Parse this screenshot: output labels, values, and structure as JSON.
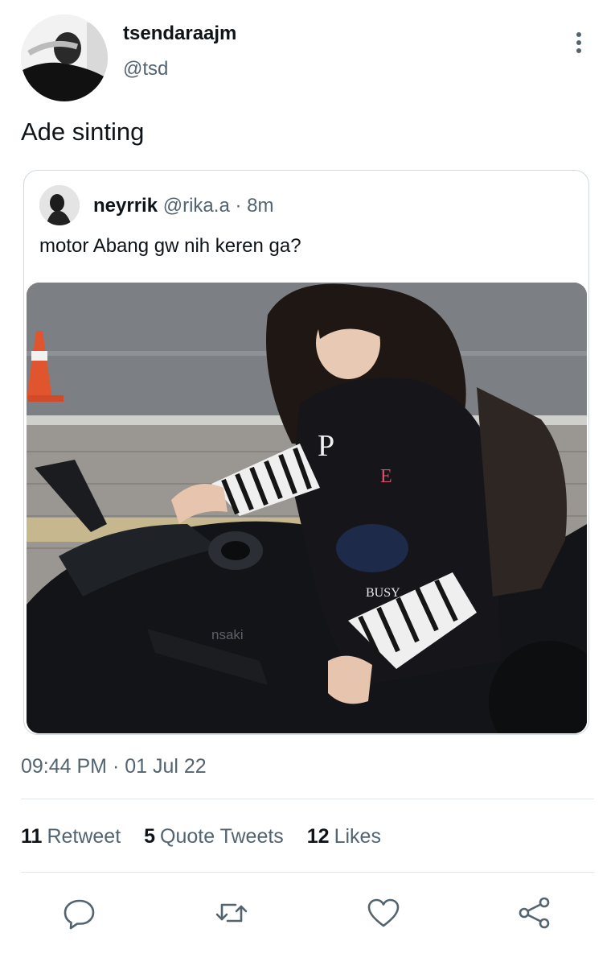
{
  "tweet": {
    "display_name": "tsendaraajm",
    "handle": "@tsd",
    "text": "Ade sinting",
    "timestamp": "09:44 PM · 01 Jul 22"
  },
  "quoted_tweet": {
    "display_name": "neyrrik",
    "handle": "@rika.a",
    "separator": "·",
    "time_ago": "8m",
    "text": "motor Abang gw nih keren ga?",
    "media_texts": [
      "P",
      "E",
      "BUSY",
      "nsaki"
    ]
  },
  "stats": [
    {
      "count": "11",
      "label": "Retweet"
    },
    {
      "count": "5",
      "label": "Quote Tweets"
    },
    {
      "count": "12",
      "label": "Likes"
    }
  ],
  "actions": [
    "reply-icon",
    "retweet-icon",
    "like-icon",
    "share-icon"
  ],
  "colors": {
    "primary_text": "#0f1419",
    "secondary_text": "#536471",
    "border": "#cfd9de",
    "divider": "#e1e6ea"
  }
}
